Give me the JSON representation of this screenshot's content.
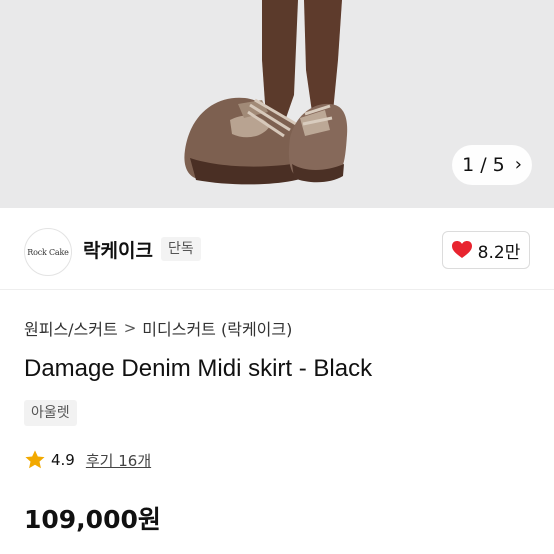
{
  "hero": {
    "counter_text": "1 / 5",
    "next_icon": "chevron-right-icon"
  },
  "seller": {
    "logo_text": "Rock Cake",
    "name": "락케이크",
    "exclusive_badge": "단독",
    "like_icon": "heart-icon",
    "like_count": "8.2만",
    "heart_color": "#e8242f"
  },
  "product": {
    "breadcrumb": [
      "원피스/스커트",
      "미디스커트 (락케이크)"
    ],
    "breadcrumb_separator": ">",
    "title": "Damage Denim Midi skirt - Black",
    "tag": "아울렛",
    "rating_icon": "star-icon",
    "star_color": "#f2a900",
    "rating": "4.9",
    "reviews": "후기 16개",
    "price": "109,000원"
  }
}
